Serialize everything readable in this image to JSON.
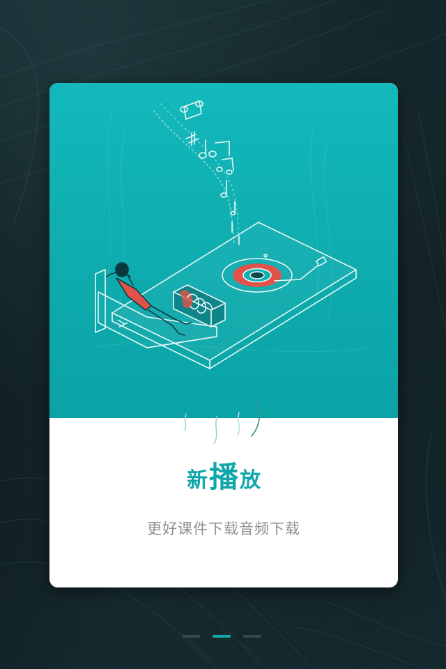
{
  "onboarding": {
    "title_prefix": "新",
    "title_main": "播",
    "title_suffix": "放",
    "subtitle": "更好课件下载音频下载"
  },
  "pager": {
    "total": 3,
    "active_index": 1
  },
  "colors": {
    "accent": "#10a7ab",
    "hero_top": "#13b9bb",
    "hero_bottom": "#0aa3a6",
    "subtitle": "#8f8f8f",
    "record_red": "#e2524a",
    "dot_inactive": "#37494c",
    "dot_active": "#14a9ad",
    "background": "#0b1a1d"
  },
  "icons": {
    "illustration": "person-lounging-record-player-illustration",
    "music_notes": "music-notes-icon"
  }
}
